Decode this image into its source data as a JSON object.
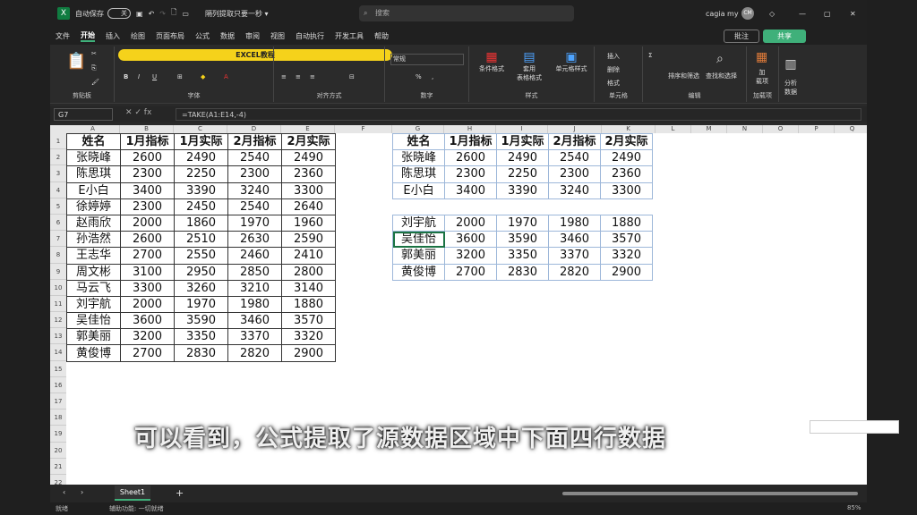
{
  "titlebar": {
    "autosave": "自动保存",
    "toggle": "关",
    "filename": "隔列提取只要一秒 ▾",
    "search": "搜索",
    "user": "cagia my",
    "avatar": "CM"
  },
  "menu": [
    "文件",
    "开始",
    "插入",
    "绘图",
    "页面布局",
    "公式",
    "数据",
    "审阅",
    "视图",
    "自动执行",
    "开发工具",
    "帮助"
  ],
  "menu_active": "开始",
  "buttons": {
    "comment": "批注",
    "share": "共享"
  },
  "ribbon": {
    "groups": [
      "剪贴板",
      "字体",
      "对齐方式",
      "数字",
      "样式",
      "单元格",
      "编辑",
      "加载项"
    ],
    "number_format": "常规",
    "cond_format": "条件格式",
    "table_format": "套用\n表格格式",
    "cell_style": "单元格样式",
    "insert": "插入",
    "delete": "删除",
    "format": "格式",
    "sort": "排序和筛选",
    "find": "查找和选择",
    "addins": "加\n载项",
    "analyze": "分析\n数据",
    "banner": "EXCEL教程"
  },
  "formula_bar": {
    "namebox": "G7",
    "formula": "=TAKE(A1:E14,-4)"
  },
  "columns": [
    "A",
    "B",
    "C",
    "D",
    "E",
    "F",
    "G",
    "H",
    "I",
    "J",
    "K",
    "L",
    "M",
    "N",
    "O",
    "P",
    "Q"
  ],
  "rows": [
    "1",
    "2",
    "3",
    "4",
    "5",
    "6",
    "7",
    "8",
    "9",
    "10",
    "11",
    "12",
    "13",
    "14",
    "15",
    "16",
    "17",
    "18",
    "19",
    "20",
    "21",
    "22"
  ],
  "table1": {
    "header": [
      "姓名",
      "1月指标",
      "1月实际",
      "2月指标",
      "2月实际"
    ],
    "rows": [
      [
        "张晓峰",
        "2600",
        "2490",
        "2540",
        "2490"
      ],
      [
        "陈思琪",
        "2300",
        "2250",
        "2300",
        "2360"
      ],
      [
        "E小白",
        "3400",
        "3390",
        "3240",
        "3300"
      ],
      [
        "徐婷婷",
        "2300",
        "2450",
        "2540",
        "2640"
      ],
      [
        "赵雨欣",
        "2000",
        "1860",
        "1970",
        "1960"
      ],
      [
        "孙浩然",
        "2600",
        "2510",
        "2630",
        "2590"
      ],
      [
        "王志华",
        "2700",
        "2550",
        "2460",
        "2410"
      ],
      [
        "周文彬",
        "3100",
        "2950",
        "2850",
        "2800"
      ],
      [
        "马云飞",
        "3300",
        "3260",
        "3210",
        "3140"
      ],
      [
        "刘宇航",
        "2000",
        "1970",
        "1980",
        "1880"
      ],
      [
        "吴佳怡",
        "3600",
        "3590",
        "3460",
        "3570"
      ],
      [
        "郭美丽",
        "3200",
        "3350",
        "3370",
        "3320"
      ],
      [
        "黄俊博",
        "2700",
        "2830",
        "2820",
        "2900"
      ]
    ]
  },
  "table2": {
    "header": [
      "姓名",
      "1月指标",
      "1月实际",
      "2月指标",
      "2月实际"
    ],
    "rows": [
      [
        "张晓峰",
        "2600",
        "2490",
        "2540",
        "2490"
      ],
      [
        "陈思琪",
        "2300",
        "2250",
        "2300",
        "2360"
      ],
      [
        "E小白",
        "3400",
        "3390",
        "3240",
        "3300"
      ]
    ]
  },
  "table3": {
    "rows": [
      [
        "刘宇航",
        "2000",
        "1970",
        "1980",
        "1880"
      ],
      [
        "吴佳怡",
        "3600",
        "3590",
        "3460",
        "3570"
      ],
      [
        "郭美丽",
        "3200",
        "3350",
        "3370",
        "3320"
      ],
      [
        "黄俊博",
        "2700",
        "2830",
        "2820",
        "2900"
      ]
    ]
  },
  "subtitle": "可以看到，公式提取了源数据区域中下面四行数据",
  "sheet": {
    "tab": "Sheet1"
  },
  "status": {
    "ready": "就绪",
    "accessibility": "辅助功能: 一切就绪",
    "zoom": "85%"
  }
}
